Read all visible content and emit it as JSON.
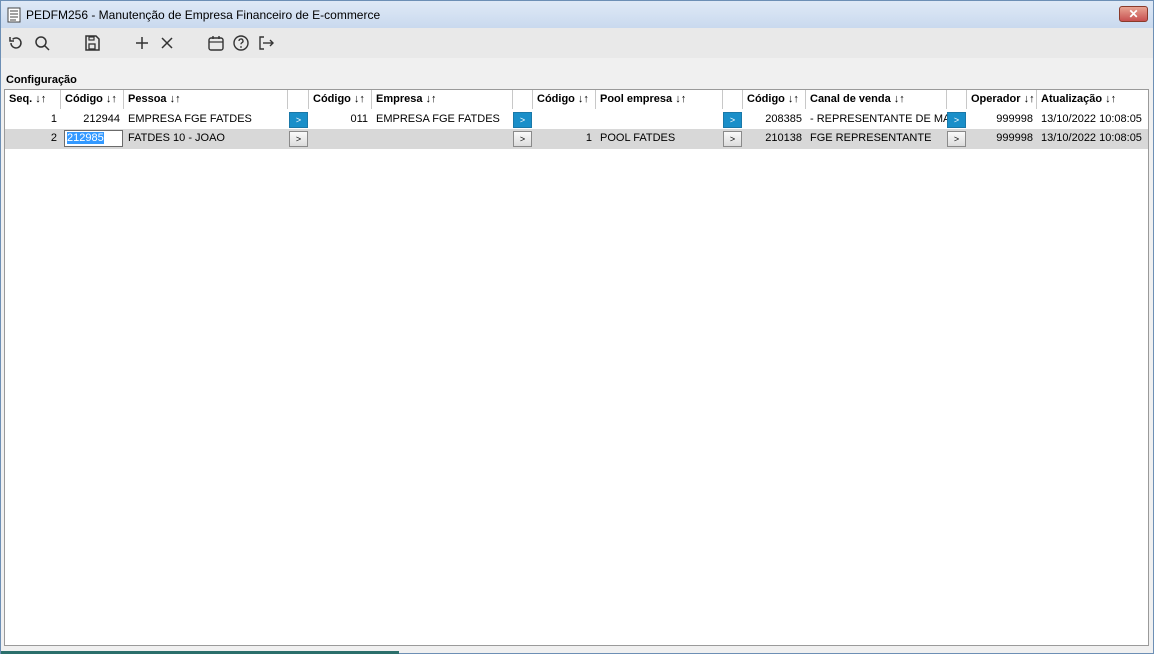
{
  "window": {
    "title": "PEDFM256 - Manutenção de Empresa Financeiro de E-commerce",
    "close_label": "✕"
  },
  "toolbar": {
    "items": [
      {
        "icon": "refresh-icon"
      },
      {
        "icon": "search-icon"
      },
      {
        "icon": "save-icon"
      },
      {
        "icon": "add-icon"
      },
      {
        "icon": "delete-icon"
      },
      {
        "icon": "calendar-icon"
      },
      {
        "icon": "help-icon"
      },
      {
        "icon": "exit-icon"
      }
    ]
  },
  "section": {
    "label": "Configuração"
  },
  "table": {
    "headers": {
      "seq": "Seq. ↓↑",
      "pessoa_codigo": "Código ↓↑",
      "pessoa": "Pessoa ↓↑",
      "empresa_codigo": "Código ↓↑",
      "empresa": "Empresa ↓↑",
      "pool_codigo": "Código ↓↑",
      "pool": "Pool empresa ↓↑",
      "canal_codigo": "Código ↓↑",
      "canal": "Canal de venda ↓↑",
      "operador": "Operador ↓↑",
      "atualizacao": "Atualização ↓↑"
    },
    "rows": [
      {
        "seq": "1",
        "pessoa_codigo": "212944",
        "pessoa": "EMPRESA FGE FATDES",
        "empresa_codigo": "011",
        "empresa": "EMPRESA FGE FATDES",
        "pool_codigo": "",
        "pool": "",
        "canal_codigo": "208385",
        "canal": "- REPRESENTANTE DE MARI",
        "operador": "999998",
        "atualizacao": "13/10/2022 10:08:05"
      },
      {
        "seq": "2",
        "pessoa_codigo": "212985",
        "pessoa": "FATDES 10 - JOAO",
        "empresa_codigo": "",
        "empresa": "",
        "pool_codigo": "1",
        "pool": "POOL FATDES",
        "canal_codigo": "210138",
        "canal": "FGE REPRESENTANTE",
        "operador": "999998",
        "atualizacao": "13/10/2022 10:08:05"
      }
    ],
    "lookup_button_label": ">"
  },
  "colors": {
    "accent": "#1a8fc9",
    "selected_row": "#d8d8d8",
    "selection": "#3399ff"
  }
}
